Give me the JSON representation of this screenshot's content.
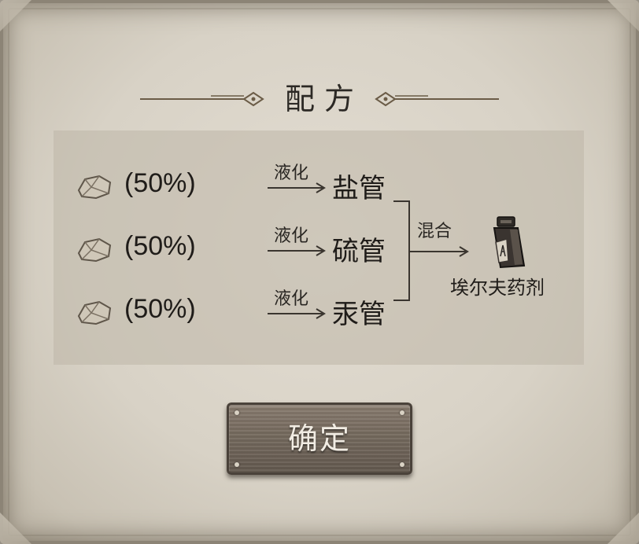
{
  "title": "配方",
  "recipe": {
    "ingredients": [
      {
        "icon": "ore-icon",
        "chance": "(50%)",
        "action": "液化",
        "product": "盐管"
      },
      {
        "icon": "ore-icon",
        "chance": "(50%)",
        "action": "液化",
        "product": "硫管"
      },
      {
        "icon": "ore-icon",
        "chance": "(50%)",
        "action": "液化",
        "product": "汞管"
      }
    ],
    "mix_label": "混合",
    "result": {
      "icon": "potion-icon",
      "name": "埃尔夫药剂"
    }
  },
  "buttons": {
    "confirm_label": "确定"
  },
  "colors": {
    "parchment": "#d8d2c6",
    "button_wood": "#756a5e",
    "text_dark": "#1f1c19"
  }
}
